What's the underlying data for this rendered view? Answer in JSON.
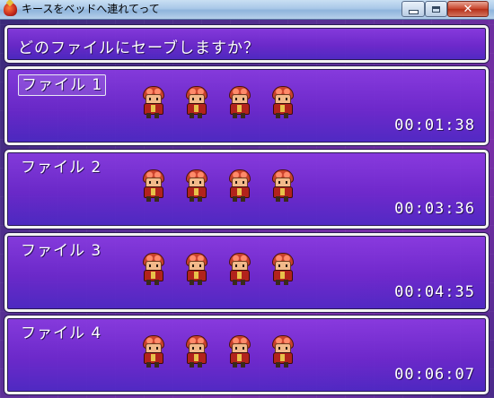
{
  "window": {
    "title": "キースをベッドへ連れてって",
    "close_glyph": "✕"
  },
  "prompt": "どのファイルにセーブしますか？",
  "slots": [
    {
      "label": "ファイル 1",
      "playtime": "00:01:38",
      "selected": true
    },
    {
      "label": "ファイル 2",
      "playtime": "00:03:36",
      "selected": false
    },
    {
      "label": "ファイル 3",
      "playtime": "00:04:35",
      "selected": false
    },
    {
      "label": "ファイル 4",
      "playtime": "00:06:07",
      "selected": false
    }
  ],
  "colors": {
    "panel_top": "#8c3ce6",
    "panel_bottom": "#4b28c8",
    "border": "#f2f2f2",
    "text": "#ffffff"
  },
  "icons": {
    "app": "red-gem-icon",
    "party_member": "red-haired-hero-sprite"
  }
}
